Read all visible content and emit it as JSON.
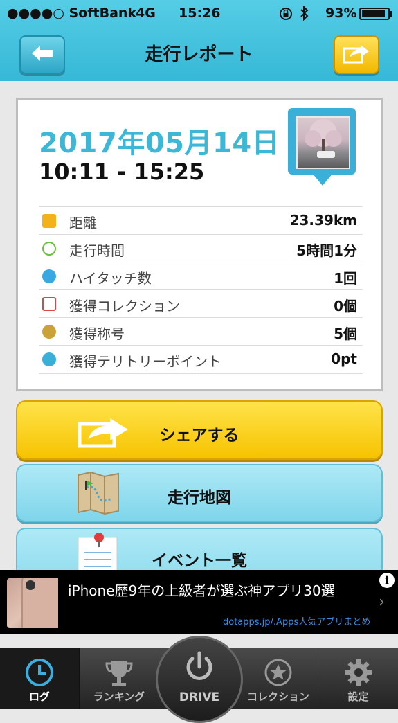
{
  "status_bar": {
    "carrier": "●●●●○ SoftBank",
    "network": "4G",
    "time": "15:26",
    "battery": "93%",
    "battery_level": 0.93
  },
  "header": {
    "title": "走行レポート",
    "back_icon": "arrow-left-icon",
    "share_icon": "share-arrow-icon"
  },
  "report": {
    "date": "2017年05月14日",
    "time_range": "10:11 - 15:25",
    "rows": [
      {
        "icon": "km-icon",
        "label": "距離",
        "value": "23.39km",
        "color": "#f3b21b"
      },
      {
        "icon": "clock-icon",
        "label": "走行時間",
        "value": "5時間1分",
        "color": "#6cbf3a"
      },
      {
        "icon": "high-five-icon",
        "label": "ハイタッチ数",
        "value": "1回",
        "color": "#3aa8e0"
      },
      {
        "icon": "car-icon",
        "label": "獲得コレクション",
        "value": "0個",
        "color": "#e04545"
      },
      {
        "icon": "medal-icon",
        "label": "獲得称号",
        "value": "5個",
        "color": "#c9a23a"
      },
      {
        "icon": "spot-icon",
        "label": "獲得テリトリーポイント",
        "value": "0pt",
        "color": "#3ab0d8"
      }
    ]
  },
  "actions": {
    "share": "シェアする",
    "map": "走行地図",
    "events": "イベント一覧"
  },
  "ad": {
    "title": "iPhone歴9年の上級者が選ぶ神アプリ30選",
    "source": "dotapps.jp/.Apps人気アプリまとめ",
    "info": "i",
    "arrow": "›"
  },
  "tabs": {
    "log": "ログ",
    "ranking": "ランキング",
    "drive": "DRIVE",
    "collection": "コレクション",
    "settings": "設定"
  },
  "colors": {
    "accent": "#3cb8d6",
    "share_yellow": "#f6c300",
    "map_blue": "#8fdcee",
    "tab_dark": "#232323"
  }
}
